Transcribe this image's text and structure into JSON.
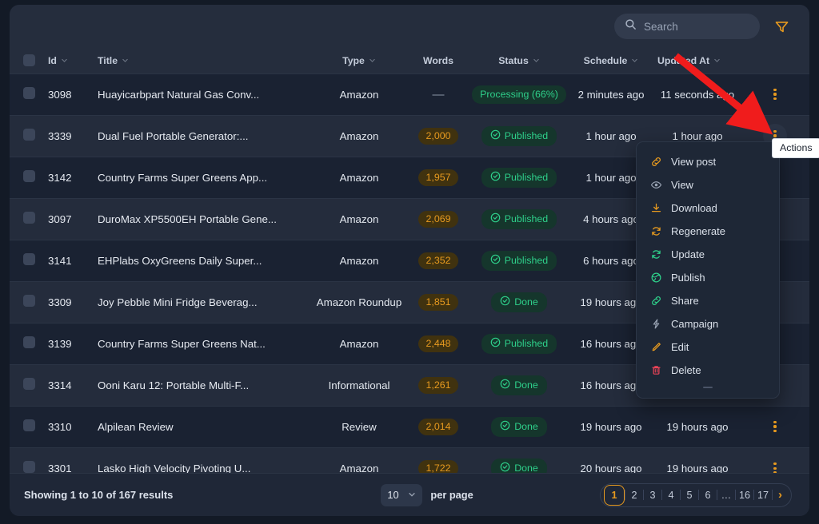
{
  "toolbar": {
    "search_placeholder": "Search",
    "search_value": "",
    "search_icon": "search-icon",
    "filter_icon": "filter-funnel-icon"
  },
  "table": {
    "columns": [
      {
        "key": "check",
        "label": "",
        "sortable": false
      },
      {
        "key": "id",
        "label": "Id",
        "sortable": true
      },
      {
        "key": "title",
        "label": "Title",
        "sortable": true
      },
      {
        "key": "type",
        "label": "Type",
        "sortable": true
      },
      {
        "key": "words",
        "label": "Words",
        "sortable": false
      },
      {
        "key": "status",
        "label": "Status",
        "sortable": true
      },
      {
        "key": "sched",
        "label": "Schedule",
        "sortable": true
      },
      {
        "key": "upd",
        "label": "Updated At",
        "sortable": true
      },
      {
        "key": "act",
        "label": "",
        "sortable": false
      }
    ],
    "rows": [
      {
        "id": "3098",
        "title": "Huayicarbpart Natural Gas Conv...",
        "type": "Amazon",
        "words": "—",
        "words_is_dash": true,
        "status": "Processing (66%)",
        "status_kind": "processing",
        "schedule": "2 minutes ago",
        "updated_at": "11 seconds ago"
      },
      {
        "id": "3339",
        "title": "Dual Fuel Portable Generator:...",
        "type": "Amazon",
        "words": "2,000",
        "words_is_dash": false,
        "status": "Published",
        "status_kind": "published",
        "schedule": "1 hour ago",
        "updated_at": "1 hour ago"
      },
      {
        "id": "3142",
        "title": "Country Farms Super Greens App...",
        "type": "Amazon",
        "words": "1,957",
        "words_is_dash": false,
        "status": "Published",
        "status_kind": "published",
        "schedule": "1 hour ago",
        "updated_at": ""
      },
      {
        "id": "3097",
        "title": "DuroMax XP5500EH Portable Gene...",
        "type": "Amazon",
        "words": "2,069",
        "words_is_dash": false,
        "status": "Published",
        "status_kind": "published",
        "schedule": "4 hours ago",
        "updated_at": ""
      },
      {
        "id": "3141",
        "title": "EHPlabs OxyGreens Daily Super...",
        "type": "Amazon",
        "words": "2,352",
        "words_is_dash": false,
        "status": "Published",
        "status_kind": "published",
        "schedule": "6 hours ago",
        "updated_at": ""
      },
      {
        "id": "3309",
        "title": "Joy Pebble Mini Fridge Beverag...",
        "type": "Amazon Roundup",
        "words": "1,851",
        "words_is_dash": false,
        "status": "Done",
        "status_kind": "done",
        "schedule": "19 hours ago",
        "updated_at": ""
      },
      {
        "id": "3139",
        "title": "Country Farms Super Greens Nat...",
        "type": "Amazon",
        "words": "2,448",
        "words_is_dash": false,
        "status": "Published",
        "status_kind": "published",
        "schedule": "16 hours ago",
        "updated_at": ""
      },
      {
        "id": "3314",
        "title": "Ooni Karu 12: Portable Multi-F...",
        "type": "Informational",
        "words": "1,261",
        "words_is_dash": false,
        "status": "Done",
        "status_kind": "done",
        "schedule": "16 hours ago",
        "updated_at": ""
      },
      {
        "id": "3310",
        "title": "Alpilean Review",
        "type": "Review",
        "words": "2,014",
        "words_is_dash": false,
        "status": "Done",
        "status_kind": "done",
        "schedule": "19 hours ago",
        "updated_at": "19 hours ago"
      },
      {
        "id": "3301",
        "title": "Lasko High Velocity Pivoting U...",
        "type": "Amazon",
        "words": "1,722",
        "words_is_dash": false,
        "status": "Done",
        "status_kind": "done",
        "schedule": "20 hours ago",
        "updated_at": "19 hours ago"
      }
    ]
  },
  "context_menu": {
    "items": [
      {
        "label": "View post",
        "icon": "link-icon",
        "color": "#e79a1f"
      },
      {
        "label": "View",
        "icon": "eye-icon",
        "color": "#9aa4b4"
      },
      {
        "label": "Download",
        "icon": "download-icon",
        "color": "#e79a1f"
      },
      {
        "label": "Regenerate",
        "icon": "refresh-icon",
        "color": "#e79a1f"
      },
      {
        "label": "Update",
        "icon": "refresh-icon",
        "color": "#2ecf8a"
      },
      {
        "label": "Publish",
        "icon": "globe-icon",
        "color": "#2ecf8a"
      },
      {
        "label": "Share",
        "icon": "link-icon",
        "color": "#2ecf8a"
      },
      {
        "label": "Campaign",
        "icon": "lightning-icon",
        "color": "#9aa4b4"
      },
      {
        "label": "Edit",
        "icon": "pencil-icon",
        "color": "#e79a1f"
      },
      {
        "label": "Delete",
        "icon": "trash-icon",
        "color": "#ef4458"
      }
    ]
  },
  "tooltip": {
    "text": "Actions"
  },
  "footer": {
    "results_text": "Showing 1 to 10 of 167 results",
    "per_page_value": "10",
    "per_page_label": "per page",
    "pages": [
      "1",
      "2",
      "3",
      "4",
      "5",
      "6",
      "…",
      "16",
      "17"
    ],
    "active_page": "1",
    "next_label": "›"
  },
  "colors": {
    "accent": "#e79a1f",
    "success": "#2ecf8a",
    "danger": "#ef4458",
    "background": "#131a26",
    "card": "#1c2433",
    "annotation_arrow": "#f01c1c"
  }
}
